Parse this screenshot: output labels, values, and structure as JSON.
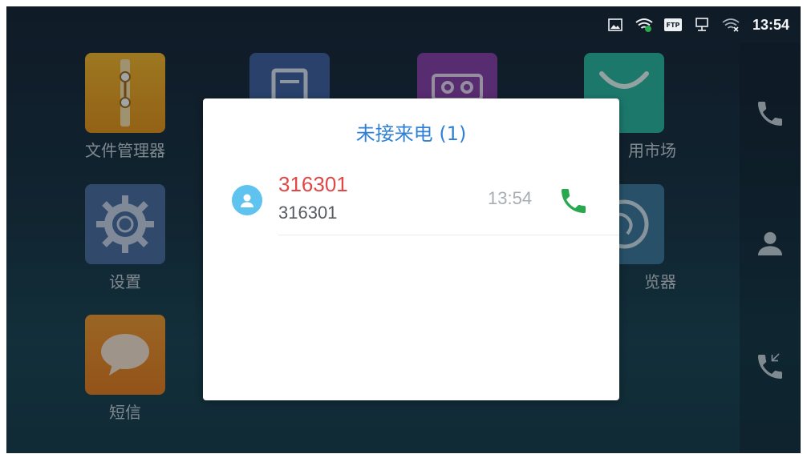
{
  "status_bar": {
    "icons": [
      "screenshot-icon",
      "wifi-icon",
      "ftp-icon",
      "network-icon",
      "wifi-off-icon"
    ],
    "ftp_label": "FTP",
    "time": "13:54"
  },
  "apps": [
    {
      "name": "file-manager",
      "label": "文件管理器",
      "color": "#f4a91e"
    },
    {
      "name": "contacts",
      "label": "",
      "color": "#3e5f9e"
    },
    {
      "name": "recorder",
      "label": "",
      "color": "#8a3ea8"
    },
    {
      "name": "app-market",
      "label": "用市场",
      "color": "#2bb8a0"
    },
    {
      "name": "settings",
      "label": "设置",
      "color": "#4b6fa0"
    },
    {
      "name": "browser",
      "label": "览器",
      "color": "#3d7a9b"
    },
    {
      "name": "messages",
      "label": "短信",
      "color": "#f08a24"
    }
  ],
  "sidebar": {
    "items": [
      "phone-icon",
      "contacts-icon",
      "call-transfer-icon"
    ]
  },
  "dialog": {
    "title": "未接来电 (1)",
    "calls": [
      {
        "name": "316301",
        "number": "316301",
        "time": "13:54"
      }
    ],
    "accent_color": "#2f80d6",
    "missed_color": "#e04848",
    "callback_color": "#2aa84f"
  }
}
